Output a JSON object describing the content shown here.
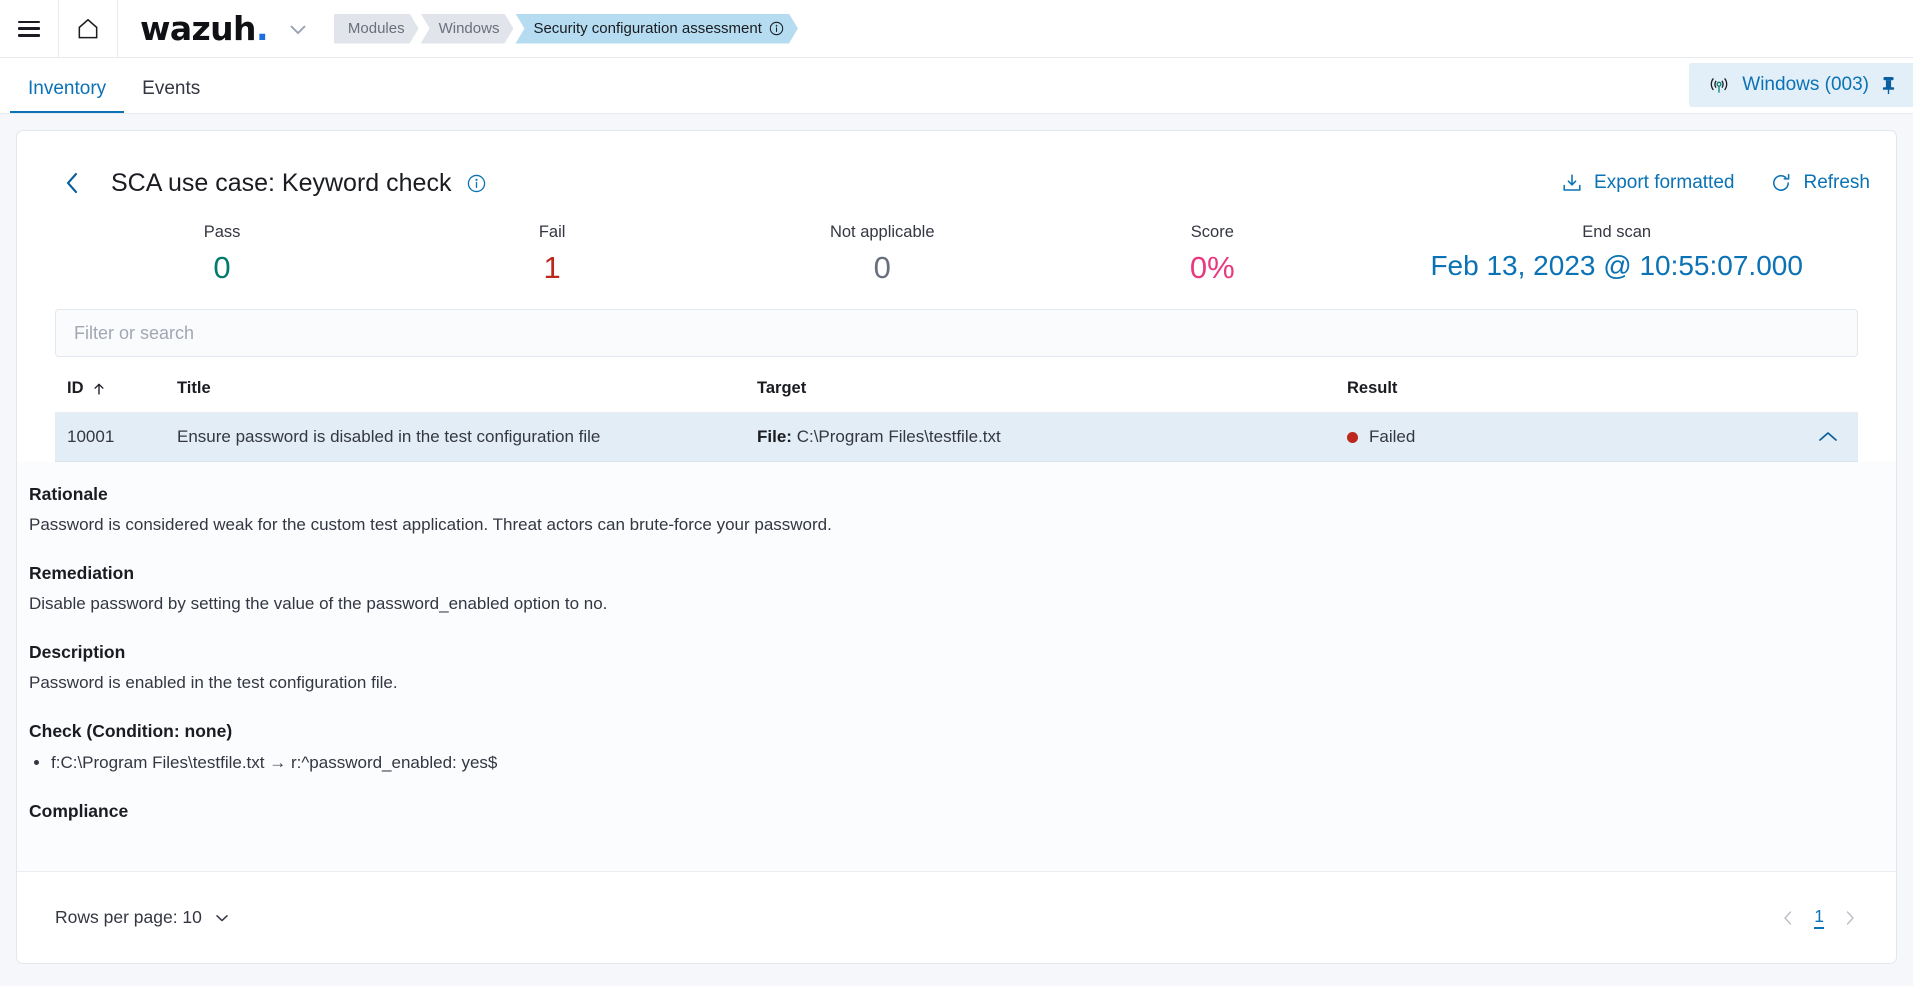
{
  "topbar": {
    "menu_icon": "hamburger-menu-icon",
    "home_icon": "home-icon",
    "logo_text": "wazuh",
    "logo_dot": ".",
    "logo_caret_icon": "chevron-down-icon",
    "breadcrumbs": [
      {
        "label": "Modules",
        "active": false
      },
      {
        "label": "Windows",
        "active": false
      },
      {
        "label": "Security configuration assessment",
        "active": true,
        "info_icon": "info-circle-icon"
      }
    ]
  },
  "tabs": {
    "items": [
      {
        "label": "Inventory",
        "active": true
      },
      {
        "label": "Events",
        "active": false
      }
    ],
    "agent": {
      "signal_icon": "antenna-signal-icon",
      "name": "Windows (003)",
      "pin_icon": "pin-icon"
    }
  },
  "policy": {
    "back_icon": "chevron-left-icon",
    "title": "SCA use case: Keyword check",
    "info_icon": "info-circle-icon",
    "actions": [
      {
        "label": "Export formatted",
        "icon": "export-download-icon"
      },
      {
        "label": "Refresh",
        "icon": "refresh-icon"
      }
    ]
  },
  "stats": [
    {
      "label": "Pass",
      "value": "0",
      "color": "#027a6e"
    },
    {
      "label": "Fail",
      "value": "1",
      "color": "#bd271e"
    },
    {
      "label": "Not applicable",
      "value": "0",
      "color": "#69707d"
    },
    {
      "label": "Score",
      "value": "0%",
      "color": "#e8397f"
    },
    {
      "label": "End scan",
      "value": "Feb 13, 2023 @ 10:55:07.000",
      "color": "#0a72b5"
    }
  ],
  "search": {
    "value": "",
    "placeholder": "Filter or search"
  },
  "table": {
    "columns": [
      {
        "label": "ID",
        "sort_icon": "arrow-up-icon"
      },
      {
        "label": "Title"
      },
      {
        "label": "Target"
      },
      {
        "label": "Result"
      }
    ],
    "rows": [
      {
        "id": "10001",
        "title": "Ensure password is disabled in the test configuration file",
        "target_label": "File:",
        "target_value": "C:\\Program Files\\testfile.txt",
        "result": "Failed",
        "result_color": "#bd271e",
        "expanded": true,
        "toggle_icon": "chevron-up-icon"
      }
    ]
  },
  "detail": {
    "rationale_heading": "Rationale",
    "rationale_text": "Password is considered weak for the custom test application. Threat actors can brute-force your password.",
    "remediation_heading": "Remediation",
    "remediation_text": "Disable password by setting the value of the password_enabled option to no.",
    "description_heading": "Description",
    "description_text": "Password is enabled in the test configuration file.",
    "check_heading": "Check (Condition: none)",
    "check_items": [
      "f:C:\\Program Files\\testfile.txt → r:^password_enabled: yes$"
    ],
    "compliance_heading": "Compliance"
  },
  "footer": {
    "rows_per_page_label": "Rows per page: 10",
    "rows_per_page_icon": "chevron-down-icon",
    "prev_icon": "chevron-left-icon",
    "next_icon": "chevron-right-icon",
    "current_page": "1"
  }
}
